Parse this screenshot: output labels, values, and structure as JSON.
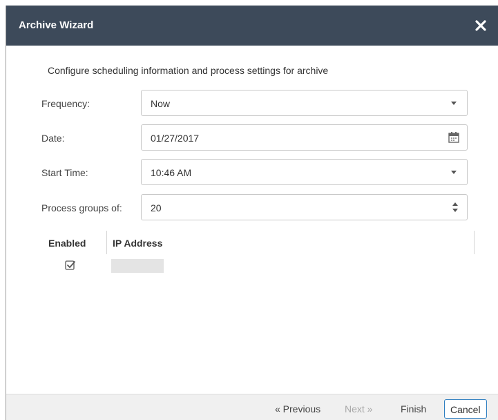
{
  "dialog": {
    "title": "Archive Wizard",
    "intro": "Configure scheduling information and process settings for archive"
  },
  "fields": {
    "frequency": {
      "label": "Frequency:",
      "value": "Now"
    },
    "date": {
      "label": "Date:",
      "value": "01/27/2017"
    },
    "start_time": {
      "label": "Start Time:",
      "value": "10:46 AM"
    },
    "process_groups": {
      "label": "Process groups of:",
      "value": "20"
    }
  },
  "grid": {
    "columns": [
      "Enabled",
      "IP Address"
    ],
    "rows": [
      {
        "enabled": true,
        "ip_address": ""
      }
    ]
  },
  "footer": {
    "previous": "« Previous",
    "next": "Next »",
    "finish": "Finish",
    "cancel": "Cancel"
  },
  "icons": {
    "close": "close-icon",
    "dropdown": "chevron-down-icon",
    "calendar": "calendar-icon",
    "spinner": "spinner-arrows-icon",
    "checkbox": "checkbox-checked-icon"
  },
  "colors": {
    "titlebar": "#3d4a5a",
    "cancel_border": "#2f7fc1",
    "footer_bg": "#f0f0f0"
  }
}
